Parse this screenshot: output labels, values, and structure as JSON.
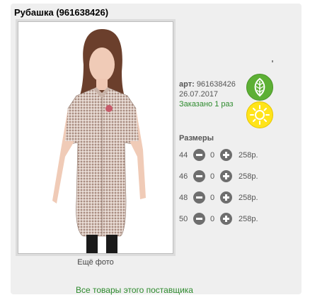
{
  "product": {
    "title": "Рубашка (961638426)",
    "more_photo": "Ещё фото",
    "article_label": "арт:",
    "article_number": "961638426",
    "date": "26.07.2017",
    "ordered": "Заказано 1 раз"
  },
  "icons": {
    "leaf": "leaf-icon",
    "sun": "sun-icon",
    "leaf_color": "#5db035",
    "sun_color": "#ffe41a"
  },
  "sizes": {
    "title": "Размеры",
    "rows": [
      {
        "size": "44",
        "qty": "0",
        "price": "258р."
      },
      {
        "size": "46",
        "qty": "0",
        "price": "258р."
      },
      {
        "size": "48",
        "qty": "0",
        "price": "258р."
      },
      {
        "size": "50",
        "qty": "0",
        "price": "258р."
      }
    ]
  },
  "footer": {
    "supplier_link": "Все товары этого поставщика"
  }
}
